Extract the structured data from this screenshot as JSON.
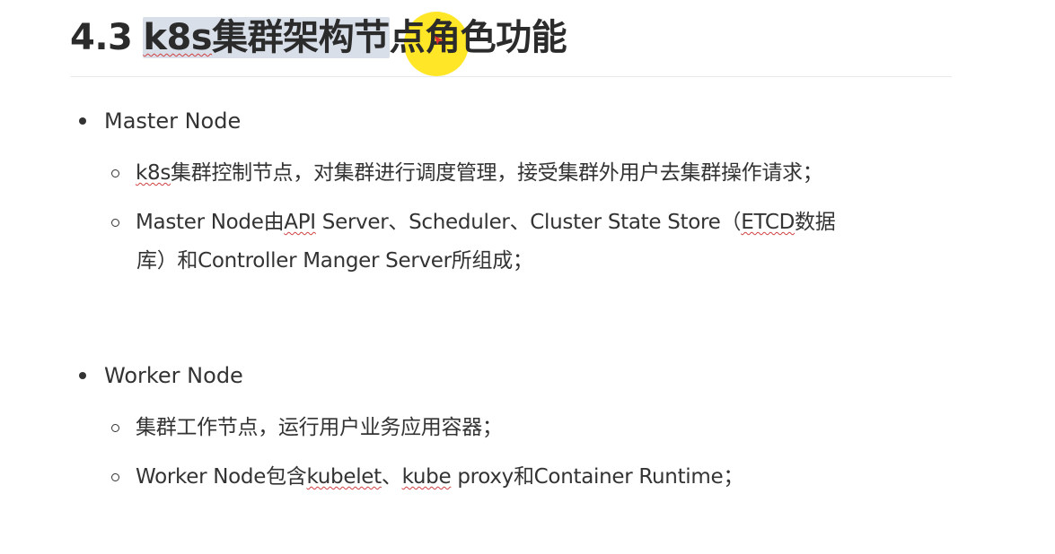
{
  "heading": {
    "number": "4.3",
    "selected_part1": "k8s",
    "selected_part2": "集群架构节",
    "rest1": "点",
    "rest2": "角色功能"
  },
  "sections": [
    {
      "title": "Master Node",
      "items": [
        {
          "part_a": "k8s",
          "part_b": "集群控制节点，对集群进行调度管理，接受集群外用户去集群操作请求；"
        },
        {
          "part_a": "Master Node由",
          "part_b": "API",
          "part_c": " Server、Scheduler、Cluster State Store（",
          "part_d": "ETCD",
          "part_e": "数据",
          "line2": "库）和Controller Manger Server所组成；"
        }
      ]
    },
    {
      "title": "Worker Node",
      "items": [
        {
          "text": "集群工作节点，运行用户业务应用容器；"
        },
        {
          "part_a": "Worker Node包含",
          "part_b": "kubelet",
          "part_c": "、",
          "part_d": "kube",
          "part_e": " proxy和Container Runtime；"
        }
      ]
    }
  ]
}
